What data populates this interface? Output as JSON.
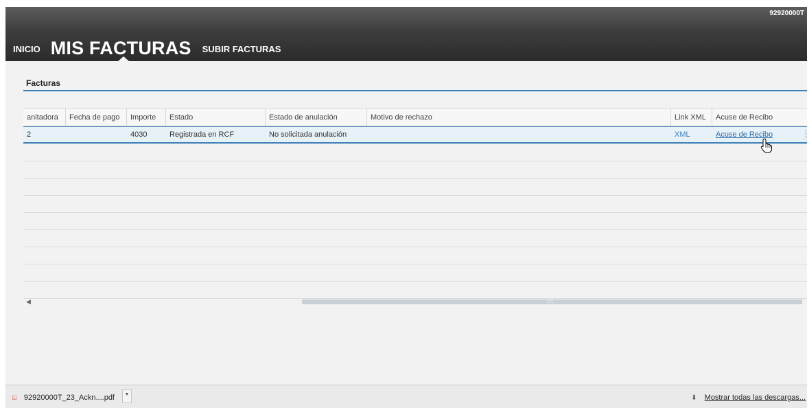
{
  "header": {
    "user_id": "92920000T",
    "nav": {
      "inicio": "INICIO",
      "mis_facturas": "MIS FACTURAS",
      "subir_facturas": "SUBIR FACTURAS"
    }
  },
  "section": {
    "title": "Facturas"
  },
  "grid": {
    "columns": [
      "anitadora",
      "Fecha de pago",
      "Importe",
      "Estado",
      "Estado de anulación",
      "Motivo de rechazo",
      "Link XML",
      "Acuse de Recibo"
    ],
    "rows": [
      {
        "tramitadora": "2",
        "fecha_pago": "",
        "importe": "4030",
        "estado": "Registrada en RCF",
        "estado_anulacion": "No solicitada anulación",
        "motivo_rechazo": "",
        "link_xml": "XML",
        "acuse_recibo": "Acuse de Recibo"
      }
    ]
  },
  "downloads": {
    "file_name": "92920000T_23_Ackn....pdf",
    "show_all": "Mostrar todas las descargas...",
    "file_icon": "pdf-icon",
    "arrow_icon": "download-arrow-icon"
  },
  "colors": {
    "accent": "#3b7fb8",
    "header_dark": "#2b2b2b",
    "background": "#f2f2f2"
  }
}
